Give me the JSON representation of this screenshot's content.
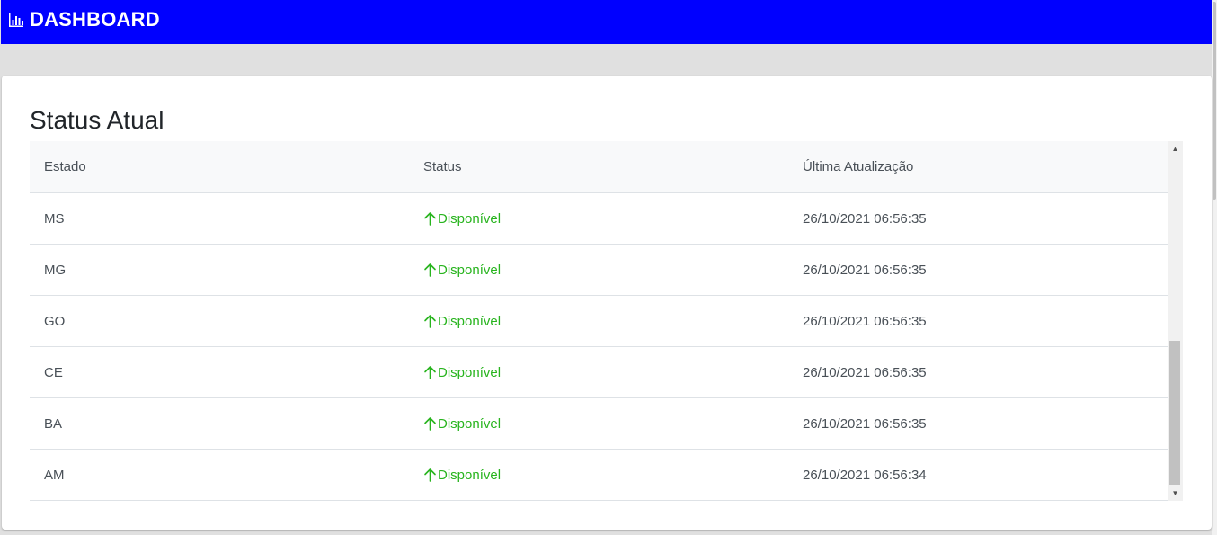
{
  "header": {
    "title": "DASHBOARD",
    "icon": "bar-chart-icon",
    "background": "#0000ff"
  },
  "card": {
    "title": "Status Atual"
  },
  "table": {
    "columns": [
      "Estado",
      "Status",
      "Última Atualização"
    ],
    "rows": [
      {
        "estado": "MS",
        "status": "Disponível",
        "updated": "26/10/2021 06:56:35"
      },
      {
        "estado": "MG",
        "status": "Disponível",
        "updated": "26/10/2021 06:56:35"
      },
      {
        "estado": "GO",
        "status": "Disponível",
        "updated": "26/10/2021 06:56:35"
      },
      {
        "estado": "CE",
        "status": "Disponível",
        "updated": "26/10/2021 06:56:35"
      },
      {
        "estado": "BA",
        "status": "Disponível",
        "updated": "26/10/2021 06:56:35"
      },
      {
        "estado": "AM",
        "status": "Disponível",
        "updated": "26/10/2021 06:56:34"
      }
    ],
    "status_icon": "arrow-up-icon",
    "status_color": "#28b41e"
  }
}
